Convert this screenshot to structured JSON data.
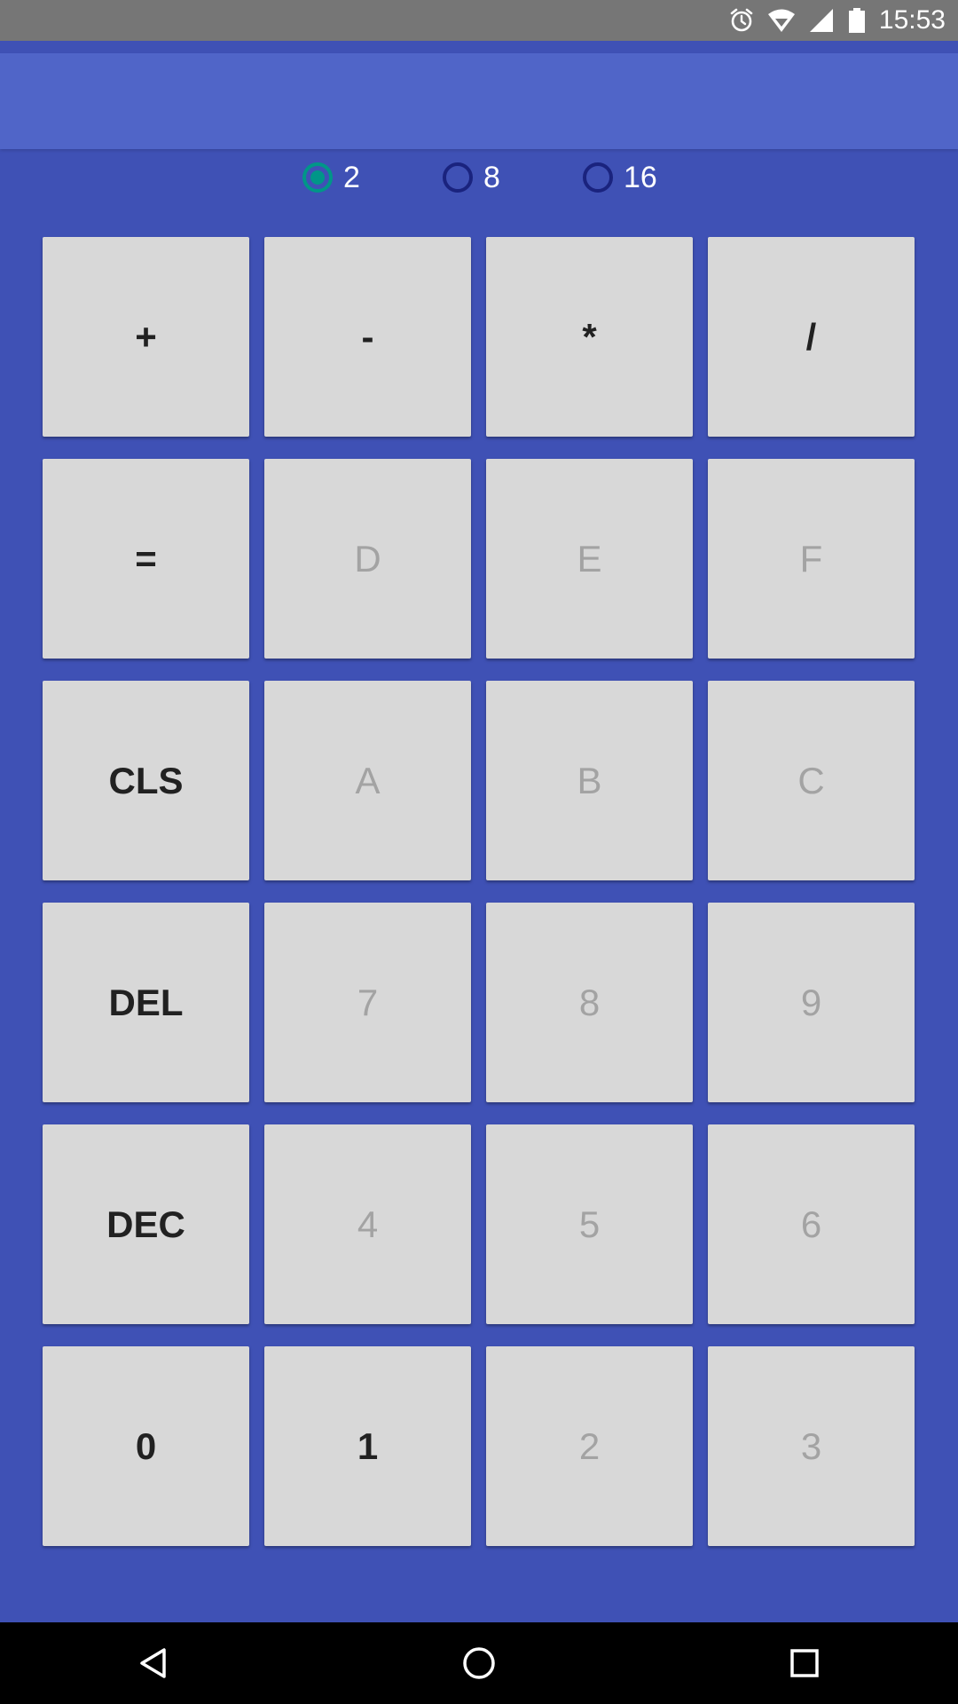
{
  "status_bar": {
    "time": "15:53",
    "icons": [
      "alarm-icon",
      "wifi-icon",
      "signal-icon",
      "battery-icon"
    ],
    "background": "#767676"
  },
  "display": {
    "value": "",
    "background": "#5065C8"
  },
  "base_selector": {
    "options": [
      {
        "label": "2",
        "checked": true
      },
      {
        "label": "8",
        "checked": false
      },
      {
        "label": "16",
        "checked": false
      }
    ],
    "checked_color": "#009688"
  },
  "keypad": {
    "rows": [
      [
        {
          "label": "+",
          "enabled": true
        },
        {
          "label": "-",
          "enabled": true
        },
        {
          "label": "*",
          "enabled": true
        },
        {
          "label": "/",
          "enabled": true
        }
      ],
      [
        {
          "label": "=",
          "enabled": true
        },
        {
          "label": "D",
          "enabled": false
        },
        {
          "label": "E",
          "enabled": false
        },
        {
          "label": "F",
          "enabled": false
        }
      ],
      [
        {
          "label": "CLS",
          "enabled": true
        },
        {
          "label": "A",
          "enabled": false
        },
        {
          "label": "B",
          "enabled": false
        },
        {
          "label": "C",
          "enabled": false
        }
      ],
      [
        {
          "label": "DEL",
          "enabled": true
        },
        {
          "label": "7",
          "enabled": false
        },
        {
          "label": "8",
          "enabled": false
        },
        {
          "label": "9",
          "enabled": false
        }
      ],
      [
        {
          "label": "DEC",
          "enabled": true
        },
        {
          "label": "4",
          "enabled": false
        },
        {
          "label": "5",
          "enabled": false
        },
        {
          "label": "6",
          "enabled": false
        }
      ],
      [
        {
          "label": "0",
          "enabled": true
        },
        {
          "label": "1",
          "enabled": true
        },
        {
          "label": "2",
          "enabled": false
        },
        {
          "label": "3",
          "enabled": false
        }
      ]
    ],
    "key_background": "#D8D8D8",
    "enabled_text_color": "#212121",
    "disabled_text_color": "#A3A3A3"
  },
  "theme": {
    "primary": "#3F51B5"
  },
  "nav_bar": {
    "icons": [
      "back-icon",
      "home-icon",
      "recents-icon"
    ]
  }
}
